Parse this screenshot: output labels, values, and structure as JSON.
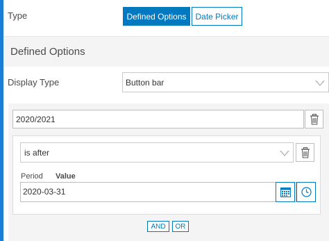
{
  "type_row": {
    "label": "Type",
    "options": [
      "Defined Options",
      "Date Picker"
    ],
    "selected": "Defined Options"
  },
  "section": {
    "title": "Defined Options"
  },
  "display_type": {
    "label": "Display Type",
    "value": "Button bar"
  },
  "period": {
    "value": "2020/2021"
  },
  "condition": {
    "operator": "is after",
    "period_label": "Period",
    "value_label": "Value",
    "date_value": "2020-03-31"
  },
  "logic": {
    "and_label": "AND",
    "or_label": "OR"
  },
  "icons": {
    "delete": "trash-icon",
    "dropdown": "chevron-down-icon",
    "calendar": "calendar-icon",
    "time": "clock-icon"
  },
  "colors": {
    "accent": "#0079c1",
    "left_strip": "#1a7fd4",
    "panel": "#f4f4f4"
  }
}
